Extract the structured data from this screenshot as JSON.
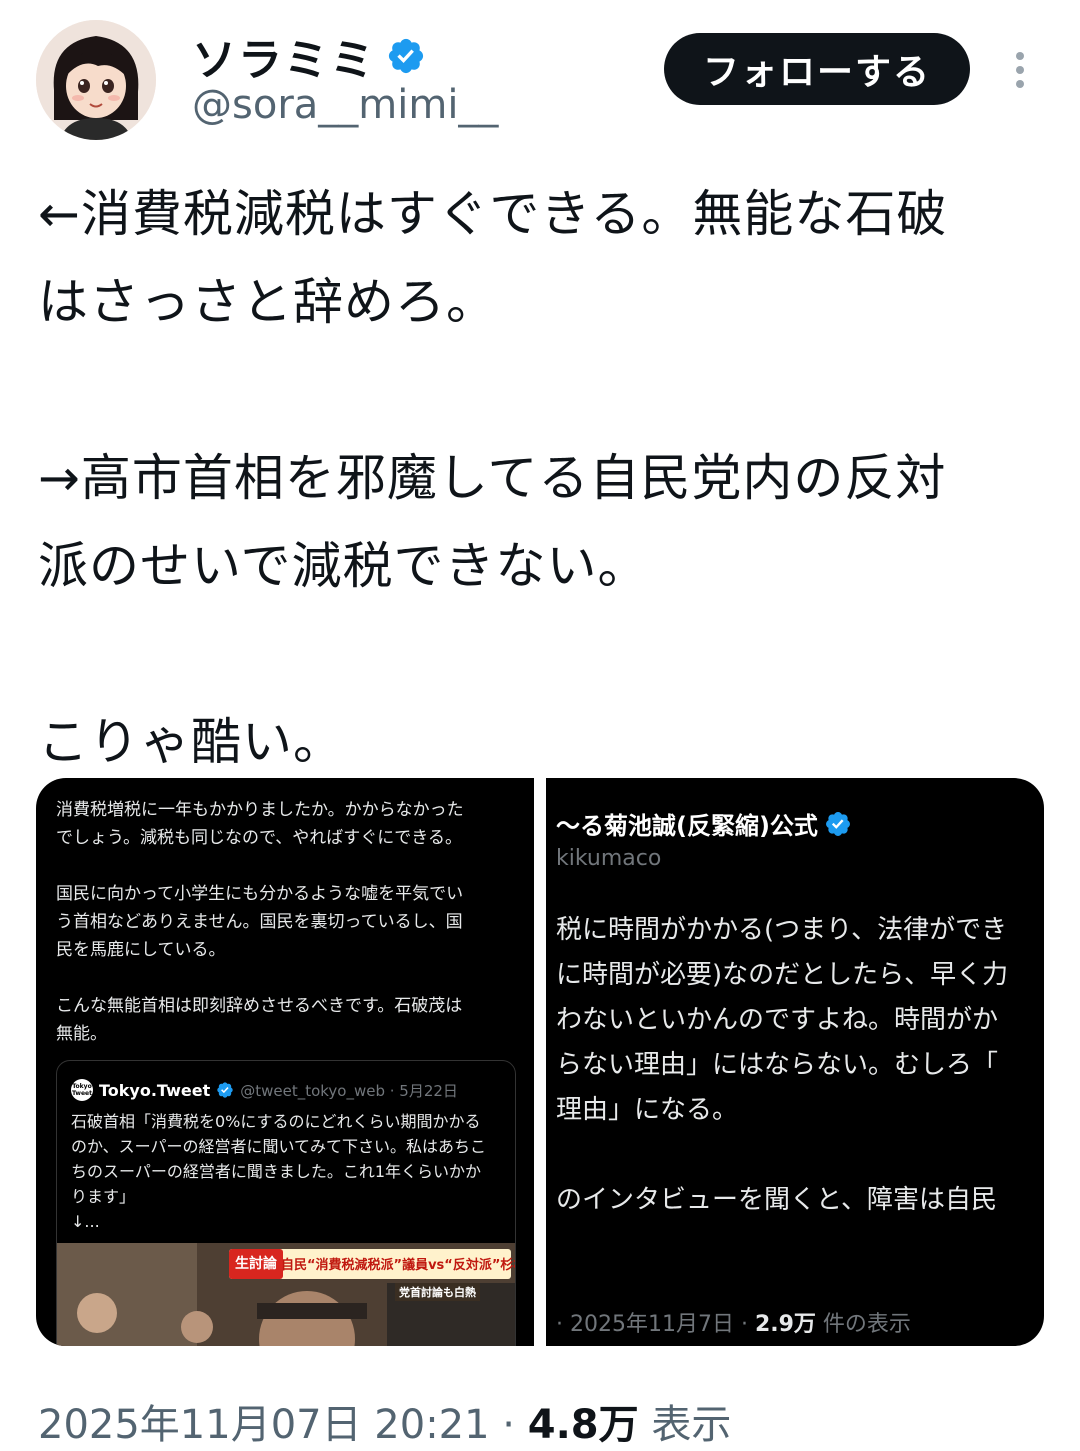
{
  "author": {
    "display_name": "ソラミミ",
    "handle": "@sora__mimi__",
    "verified": true
  },
  "follow_button_label": "フォローする",
  "tweet_text": "←消費税減税はすぐできる。無能な石破\nはさっさと辞めろ。\n\n→高市首相を邪魔してる自民党内の反対\n派のせいで減税できない。\n\nこりゃ酷い。",
  "media_left": {
    "paragraph1": "消費税増税に一年もかかりましたか。かからなかった\nでしょう。減税も同じなので、やればすぐにできる。",
    "paragraph2": "国民に向かって小学生にも分かるような嘘を平気でい\nう首相などありえません。国民を裏切っているし、国\n民を馬鹿にしている。",
    "paragraph3": "こんな無能首相は即刻辞めさせるべきです。石破茂は\n無能。",
    "quote": {
      "logo_text": "Tokyo Tweet",
      "name": "Tokyo.Tweet",
      "handle_date": "@tweet_tokyo_web · 5月22日",
      "body": "石破首相「消費税を0%にするのにどれくらい期間かかる\nのか、スーパーの経営者に聞いてみて下さい。私はあちこ\nちのスーパーの経営者に聞きました。これ1年くらいかか\nります」\n↓...",
      "banner_tag": "生討論",
      "banner_text": "自民“消費税減税派”議員vs“反対派”杉村太蔵",
      "banner_sub": "党首討論も白熱"
    }
  },
  "media_right": {
    "name": "〜る菊池誠(反緊縮)公式",
    "handle": "kikumaco",
    "body": "税に時間がかかる(つまり、法律ができ\nに時間が必要)なのだとしたら、早く⼒\nわないといかんのですよね。時間がか\nらない理由」にはならない。むしろ「\n理由」になる。\n\nのインタビューを聞くと、障害は自民",
    "footer_date": "· 2025年11月7日 · ",
    "footer_views": "2.9万",
    "footer_suffix": " 件の表示"
  },
  "timestamp": {
    "datetime": "2025年11月07日 20:21",
    "separator": " · ",
    "views": "4.8万",
    "views_label": " 表示"
  },
  "colors": {
    "verified_blue": "#1d9bf0",
    "text_primary": "#0f1419",
    "text_secondary": "#536471"
  }
}
